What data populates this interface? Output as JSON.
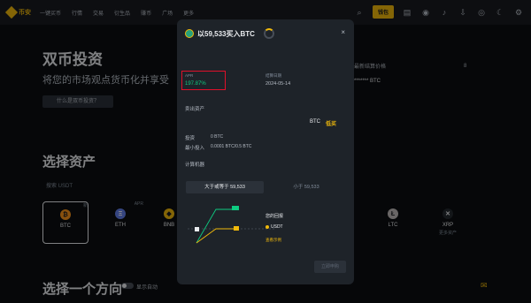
{
  "nav": {
    "logo": "币安",
    "items": [
      "一键买币",
      "行情",
      "交易",
      "衍生品",
      "赚币",
      "广场",
      "更多"
    ],
    "wallet_label": "钱包"
  },
  "hero": {
    "title": "双币投资",
    "subtitle": "将您的市场观点货币化并享受",
    "button": "什么是双币投资？"
  },
  "right_peek": {
    "label": "最新结算价格",
    "masked": "******* BTC",
    "count": "8"
  },
  "select_asset": {
    "title": "选择资产",
    "search": "搜索 USDT",
    "tiles": [
      {
        "symbol": "BTC",
        "sub": "",
        "color": "#f7931a",
        "glyph": "₿",
        "badge": "新",
        "selected": true
      },
      {
        "symbol": "ETH",
        "sub": "",
        "color": "#627eea",
        "glyph": "Ξ",
        "badge": "APR",
        "selected": false
      },
      {
        "symbol": "BNB",
        "sub": "",
        "color": "#f0b90b",
        "glyph": "◆",
        "badge": "",
        "selected": false
      },
      {
        "symbol": "LTC",
        "sub": "",
        "color": "#bfbbbb",
        "glyph": "Ł",
        "badge": "",
        "selected": false
      },
      {
        "symbol": "XRP",
        "sub": "更多资产",
        "color": "#23292f",
        "glyph": "✕",
        "badge": "",
        "selected": false
      }
    ]
  },
  "direction": {
    "title": "选择一个方向",
    "toggle_label": "显示自动"
  },
  "modal": {
    "title": "以59,533买入BTC",
    "close": "×",
    "apr_label": "APR",
    "apr_value": "197.87%",
    "settle_label": "结算日期",
    "settle_value": "2024-05-14",
    "sell_section": "卖出资产",
    "sell_asset": "BTC",
    "sell_dir": "低买",
    "rows": [
      {
        "label": "投资",
        "value": "0 BTC"
      },
      {
        "label": "最小投入",
        "value": "0.0001 BTC/0.5 BTC"
      }
    ],
    "calc_label": "计算机器",
    "tabs": [
      "大于或等于 59,533",
      "小于 59,533"
    ],
    "legend1": "您的回报",
    "legend2": "USDT",
    "legend3": "查看示例",
    "confirm": "立即申购"
  }
}
